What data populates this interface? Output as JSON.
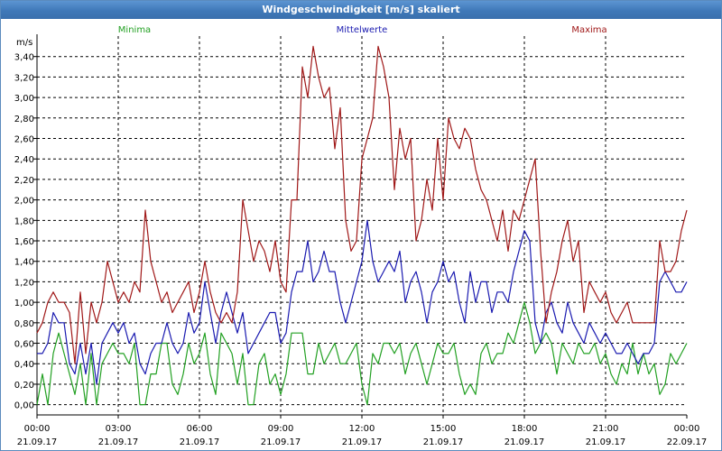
{
  "window": {
    "title": "Windgeschwindigkeit [m/s] skaliert"
  },
  "colors": {
    "minima": "#22a022",
    "mittelwerte": "#1a1ab0",
    "maxima": "#a01818",
    "titlebar": "#3f78b8",
    "grid": "#000000"
  },
  "chart_data": {
    "type": "line",
    "title": "Windgeschwindigkeit [m/s] skaliert",
    "ylabel": "m/s",
    "xlabel": "",
    "ylim": [
      -0.1,
      3.6
    ],
    "xlim": [
      0,
      24
    ],
    "grid": true,
    "legend_position": "top",
    "y_ticks": [
      "0,00",
      "0,20",
      "0,40",
      "0,60",
      "0,80",
      "1,00",
      "1,20",
      "1,40",
      "1,60",
      "1,80",
      "2,00",
      "2,20",
      "2,40",
      "2,60",
      "2,80",
      "3,00",
      "3,20",
      "3,40"
    ],
    "x_ticks": [
      {
        "time": "00:00",
        "date": "21.09.17"
      },
      {
        "time": "03:00",
        "date": "21.09.17"
      },
      {
        "time": "06:00",
        "date": "21.09.17"
      },
      {
        "time": "09:00",
        "date": "21.09.17"
      },
      {
        "time": "12:00",
        "date": "21.09.17"
      },
      {
        "time": "15:00",
        "date": "21.09.17"
      },
      {
        "time": "18:00",
        "date": "21.09.17"
      },
      {
        "time": "21:00",
        "date": "21.09.17"
      },
      {
        "time": "00:00",
        "date": "22.09.17"
      }
    ],
    "x_hours": [
      0,
      0.2,
      0.4,
      0.6,
      0.8,
      1,
      1.2,
      1.4,
      1.6,
      1.8,
      2,
      2.2,
      2.4,
      2.6,
      2.8,
      3,
      3.2,
      3.4,
      3.6,
      3.8,
      4,
      4.2,
      4.4,
      4.6,
      4.8,
      5,
      5.2,
      5.4,
      5.6,
      5.8,
      6,
      6.2,
      6.4,
      6.6,
      6.8,
      7,
      7.2,
      7.4,
      7.6,
      7.8,
      8,
      8.2,
      8.4,
      8.6,
      8.8,
      9,
      9.2,
      9.4,
      9.6,
      9.8,
      10,
      10.2,
      10.4,
      10.6,
      10.8,
      11,
      11.2,
      11.4,
      11.6,
      11.8,
      12,
      12.2,
      12.4,
      12.6,
      12.8,
      13,
      13.2,
      13.4,
      13.6,
      13.8,
      14,
      14.2,
      14.4,
      14.6,
      14.8,
      15,
      15.2,
      15.4,
      15.6,
      15.8,
      16,
      16.2,
      16.4,
      16.6,
      16.8,
      17,
      17.2,
      17.4,
      17.6,
      17.8,
      18,
      18.2,
      18.4,
      18.6,
      18.8,
      19,
      19.2,
      19.4,
      19.6,
      19.8,
      20,
      20.2,
      20.4,
      20.6,
      20.8,
      21,
      21.2,
      21.4,
      21.6,
      21.8,
      22,
      22.2,
      22.4,
      22.6,
      22.8,
      23,
      23.2,
      23.4,
      23.6,
      23.8,
      24
    ],
    "series": [
      {
        "name": "Minima",
        "color": "#22a022",
        "values": [
          0,
          0.3,
          0,
          0.5,
          0.7,
          0.5,
          0.3,
          0.1,
          0.4,
          0,
          0.5,
          0,
          0.4,
          0.5,
          0.6,
          0.5,
          0.5,
          0.4,
          0.6,
          0,
          0,
          0.3,
          0.3,
          0.6,
          0.6,
          0.2,
          0.1,
          0.3,
          0.6,
          0.4,
          0.5,
          0.7,
          0.3,
          0.1,
          0.7,
          0.6,
          0.5,
          0.2,
          0.5,
          0,
          0,
          0.4,
          0.5,
          0.2,
          0.3,
          0.1,
          0.3,
          0.7,
          0.7,
          0.7,
          0.3,
          0.3,
          0.6,
          0.4,
          0.5,
          0.6,
          0.4,
          0.4,
          0.5,
          0.6,
          0.2,
          0,
          0.5,
          0.4,
          0.6,
          0.6,
          0.5,
          0.6,
          0.3,
          0.5,
          0.6,
          0.4,
          0.2,
          0.4,
          0.6,
          0.5,
          0.5,
          0.6,
          0.3,
          0.1,
          0.2,
          0.1,
          0.5,
          0.6,
          0.4,
          0.5,
          0.5,
          0.7,
          0.6,
          0.8,
          1.0,
          0.8,
          0.5,
          0.6,
          0.7,
          0.6,
          0.3,
          0.6,
          0.5,
          0.4,
          0.6,
          0.5,
          0.5,
          0.6,
          0.4,
          0.5,
          0.3,
          0.2,
          0.4,
          0.3,
          0.6,
          0.3,
          0.5,
          0.3,
          0.4,
          0.1,
          0.2,
          0.5,
          0.4,
          0.5,
          0.6
        ]
      },
      {
        "name": "Mittelwerte",
        "color": "#1a1ab0",
        "values": [
          0.5,
          0.5,
          0.6,
          0.9,
          0.8,
          0.8,
          0.4,
          0.3,
          0.6,
          0.3,
          0.6,
          0.2,
          0.6,
          0.7,
          0.8,
          0.7,
          0.8,
          0.6,
          0.7,
          0.4,
          0.3,
          0.5,
          0.6,
          0.6,
          0.8,
          0.6,
          0.5,
          0.6,
          0.9,
          0.7,
          0.8,
          1.2,
          0.9,
          0.6,
          0.9,
          1.1,
          0.9,
          0.7,
          0.9,
          0.5,
          0.6,
          0.7,
          0.8,
          0.9,
          0.9,
          0.6,
          0.7,
          1.1,
          1.3,
          1.3,
          1.6,
          1.2,
          1.3,
          1.5,
          1.3,
          1.3,
          1.0,
          0.8,
          1.0,
          1.2,
          1.4,
          1.8,
          1.4,
          1.2,
          1.3,
          1.4,
          1.3,
          1.5,
          1.0,
          1.2,
          1.3,
          1.1,
          0.8,
          1.1,
          1.2,
          1.4,
          1.2,
          1.3,
          1.0,
          0.8,
          1.3,
          1.0,
          1.2,
          1.2,
          0.9,
          1.1,
          1.1,
          1.0,
          1.3,
          1.5,
          1.7,
          1.6,
          0.8,
          0.6,
          0.9,
          1.0,
          0.8,
          0.7,
          1.0,
          0.8,
          0.7,
          0.6,
          0.8,
          0.7,
          0.6,
          0.7,
          0.6,
          0.5,
          0.5,
          0.6,
          0.5,
          0.4,
          0.5,
          0.5,
          0.6,
          1.2,
          1.3,
          1.2,
          1.1,
          1.1,
          1.2
        ]
      },
      {
        "name": "Maxima",
        "color": "#a01818",
        "values": [
          0.7,
          0.8,
          1.0,
          1.1,
          1.0,
          1.0,
          0.9,
          0.4,
          1.1,
          0.5,
          1.0,
          0.8,
          1.0,
          1.4,
          1.2,
          1.0,
          1.1,
          1.0,
          1.2,
          1.1,
          1.9,
          1.4,
          1.2,
          1.0,
          1.1,
          0.9,
          1.0,
          1.1,
          1.2,
          0.9,
          1.1,
          1.4,
          1.1,
          0.9,
          0.8,
          0.9,
          0.8,
          1.1,
          2.0,
          1.7,
          1.4,
          1.6,
          1.5,
          1.3,
          1.6,
          1.2,
          1.1,
          2.0,
          2.0,
          3.3,
          3.0,
          3.5,
          3.2,
          3.0,
          3.1,
          2.5,
          2.9,
          1.8,
          1.5,
          1.6,
          2.4,
          2.6,
          2.8,
          3.5,
          3.3,
          3.0,
          2.1,
          2.7,
          2.4,
          2.6,
          1.6,
          1.8,
          2.2,
          1.9,
          2.6,
          2.0,
          2.8,
          2.6,
          2.5,
          2.7,
          2.6,
          2.3,
          2.1,
          2.0,
          1.8,
          1.6,
          1.9,
          1.5,
          1.9,
          1.8,
          2.0,
          2.2,
          2.4,
          1.5,
          0.8,
          1.1,
          1.3,
          1.6,
          1.8,
          1.4,
          1.6,
          0.9,
          1.2,
          1.1,
          1.0,
          1.1,
          0.9,
          0.8,
          0.9,
          1.0,
          0.8,
          0.8,
          0.8,
          0.8,
          0.8,
          1.6,
          1.3,
          1.3,
          1.4,
          1.7,
          1.9
        ]
      }
    ]
  }
}
